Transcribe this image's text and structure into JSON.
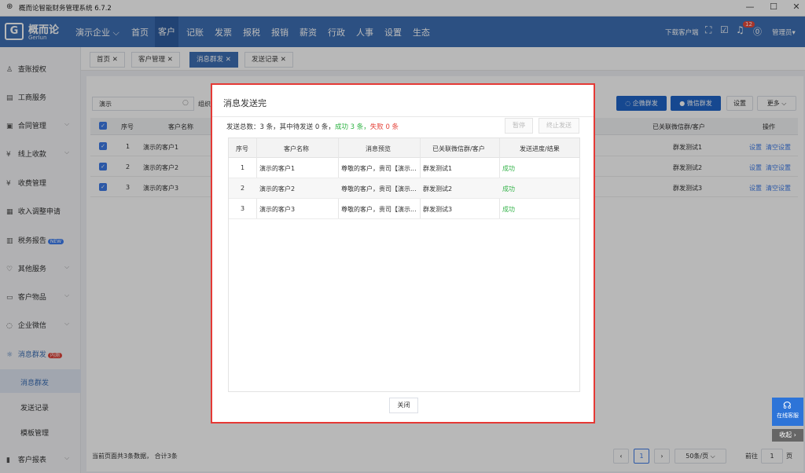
{
  "window": {
    "title": "概而论智能财务管理系统 6.7.2"
  },
  "logo": {
    "name": "概而论",
    "sub": "Gerlun"
  },
  "nav": {
    "company": "演示企业",
    "items": [
      "首页",
      "客户",
      "记账",
      "发票",
      "报税",
      "报销",
      "薪资",
      "行政",
      "人事",
      "设置",
      "生态"
    ],
    "download": "下载客户端",
    "notif_count": "12",
    "user": "管理员"
  },
  "sidebar": {
    "items": [
      {
        "label": "查账授权"
      },
      {
        "label": "工商服务"
      },
      {
        "label": "合同管理"
      },
      {
        "label": "线上收款"
      },
      {
        "label": "收费管理"
      },
      {
        "label": "收入调整申请"
      },
      {
        "label": "税务报告",
        "badge": "NEW"
      },
      {
        "label": "其他服务"
      },
      {
        "label": "客户物品"
      },
      {
        "label": "企业微信"
      },
      {
        "label": "消息群发",
        "badge": "内测"
      },
      {
        "label": "消息群发"
      },
      {
        "label": "发送记录"
      },
      {
        "label": "模板管理"
      },
      {
        "label": "客户报表"
      }
    ]
  },
  "tabs": [
    "首页",
    "客户管理",
    "消息群发",
    "发送记录"
  ],
  "filter": {
    "search_value": "演示",
    "org_label": "组织"
  },
  "toolbar": {
    "wecom": "企微群发",
    "wechat": "微信群发",
    "settings": "设置",
    "more": "更多"
  },
  "bg_table": {
    "headers": {
      "index": "序号",
      "name": "客户名称",
      "group": "已关联微信群/客户",
      "ops": "操作"
    },
    "rows": [
      {
        "index": "1",
        "name": "演示的客户1",
        "group": "群发测试1",
        "op1": "设置",
        "op2": "清空设置"
      },
      {
        "index": "2",
        "name": "演示的客户2",
        "group": "群发测试2",
        "op1": "设置",
        "op2": "清空设置"
      },
      {
        "index": "3",
        "name": "演示的客户3",
        "group": "群发测试3",
        "op1": "设置",
        "op2": "清空设置"
      }
    ]
  },
  "footer": {
    "summary": "当前页面共3条数据， 合计3条",
    "page": "1",
    "page_size": "50条/页",
    "goto_label": "前往",
    "goto_value": "1",
    "page_unit": "页"
  },
  "float": {
    "service": "在线客服",
    "fold": "收起"
  },
  "modal": {
    "title": "消息发送完",
    "summary_prefix": "发送总数：3 条，其中待发送 0 条，",
    "summary_success": "成功 3 条，",
    "summary_fail": "失败 0 条",
    "pause": "暂停",
    "stop": "终止发送",
    "headers": {
      "index": "序号",
      "name": "客户名称",
      "preview": "消息预览",
      "group": "已关联微信群/客户",
      "progress": "发送进度/结果"
    },
    "rows": [
      {
        "index": "1",
        "name": "演示的客户1",
        "preview": "尊敬的客户，贵司【演示...",
        "group": "群发测试1",
        "status": "成功"
      },
      {
        "index": "2",
        "name": "演示的客户2",
        "preview": "尊敬的客户，贵司【演示...",
        "group": "群发测试2",
        "status": "成功"
      },
      {
        "index": "3",
        "name": "演示的客户3",
        "preview": "尊敬的客户，贵司【演示...",
        "group": "群发测试3",
        "status": "成功"
      }
    ],
    "close": "关闭"
  }
}
